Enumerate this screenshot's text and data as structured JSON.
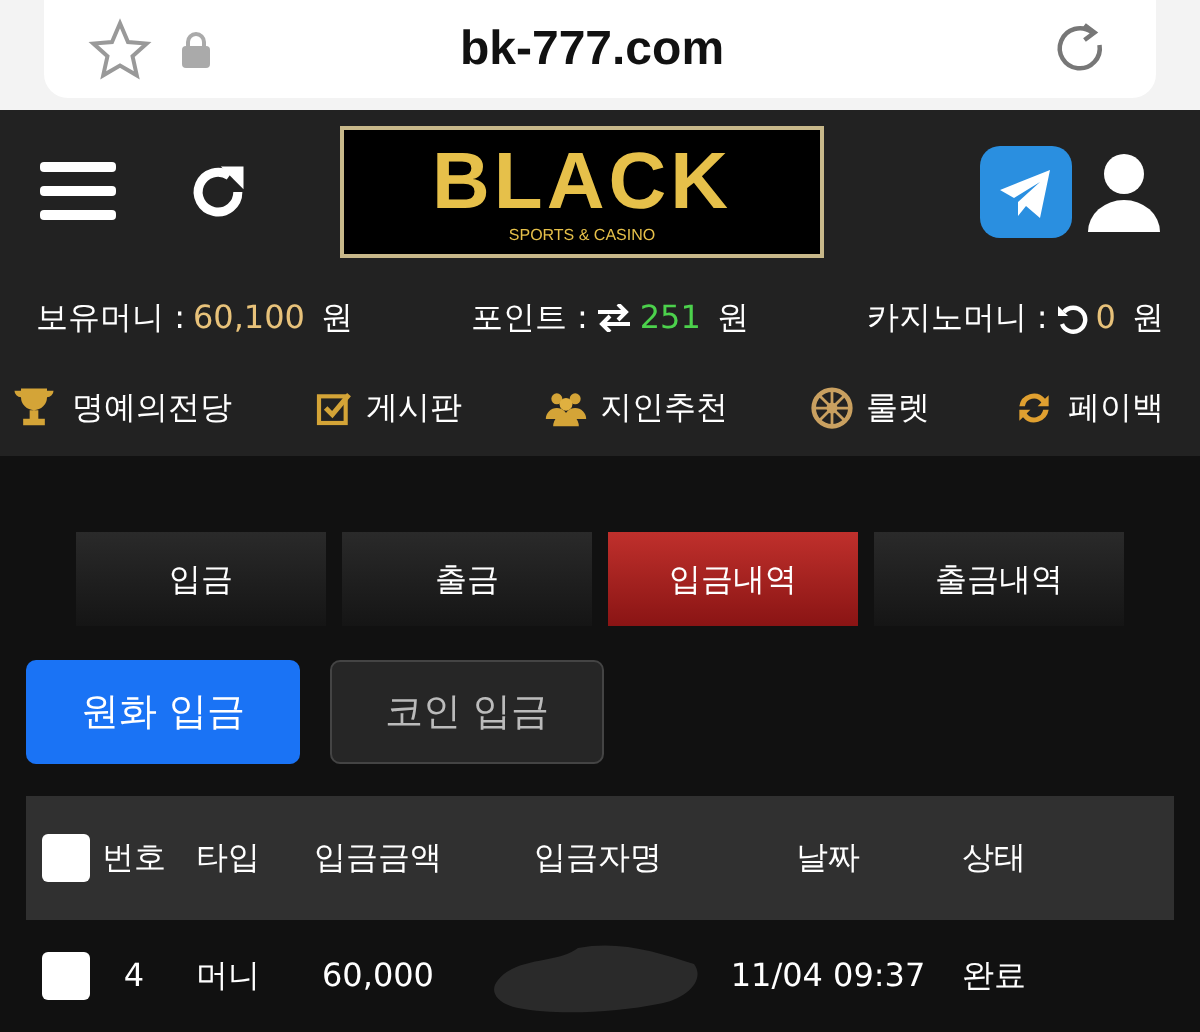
{
  "browser": {
    "url": "bk-777.com"
  },
  "header": {
    "logo": "BLACK",
    "logo_tagline": "SPORTS & CASINO"
  },
  "balances": [
    {
      "label": "보유머니 :",
      "value": "60,100",
      "unit": "원",
      "kind": "money"
    },
    {
      "label": "포인트 :",
      "value": "251",
      "unit": "원",
      "kind": "point"
    },
    {
      "label": "카지노머니 :",
      "value": "0",
      "unit": "원",
      "kind": "casino"
    }
  ],
  "menu": [
    {
      "label": "명예의전당",
      "kind": "trophy"
    },
    {
      "label": "게시판",
      "kind": "board"
    },
    {
      "label": "지인추천",
      "kind": "friends"
    },
    {
      "label": "룰렛",
      "kind": "roulette"
    },
    {
      "label": "페이백",
      "kind": "payback"
    }
  ],
  "tabs": [
    {
      "label": "입금",
      "selected": false
    },
    {
      "label": "출금",
      "selected": false
    },
    {
      "label": "입금내역",
      "selected": true
    },
    {
      "label": "출금내역",
      "selected": false
    }
  ],
  "deposit_types": [
    {
      "label": "원화 입금",
      "selected": true
    },
    {
      "label": "코인 입금",
      "selected": false
    }
  ],
  "table": {
    "select_all_checked": false,
    "columns": [
      "번호",
      "타입",
      "입금금액",
      "입금자명",
      "날짜",
      "상태"
    ],
    "rows": [
      {
        "checked": false,
        "cells": [
          "4",
          "머니",
          "60,000",
          "",
          "11/04 09:37",
          "완료"
        ],
        "name_redacted": true
      }
    ]
  }
}
